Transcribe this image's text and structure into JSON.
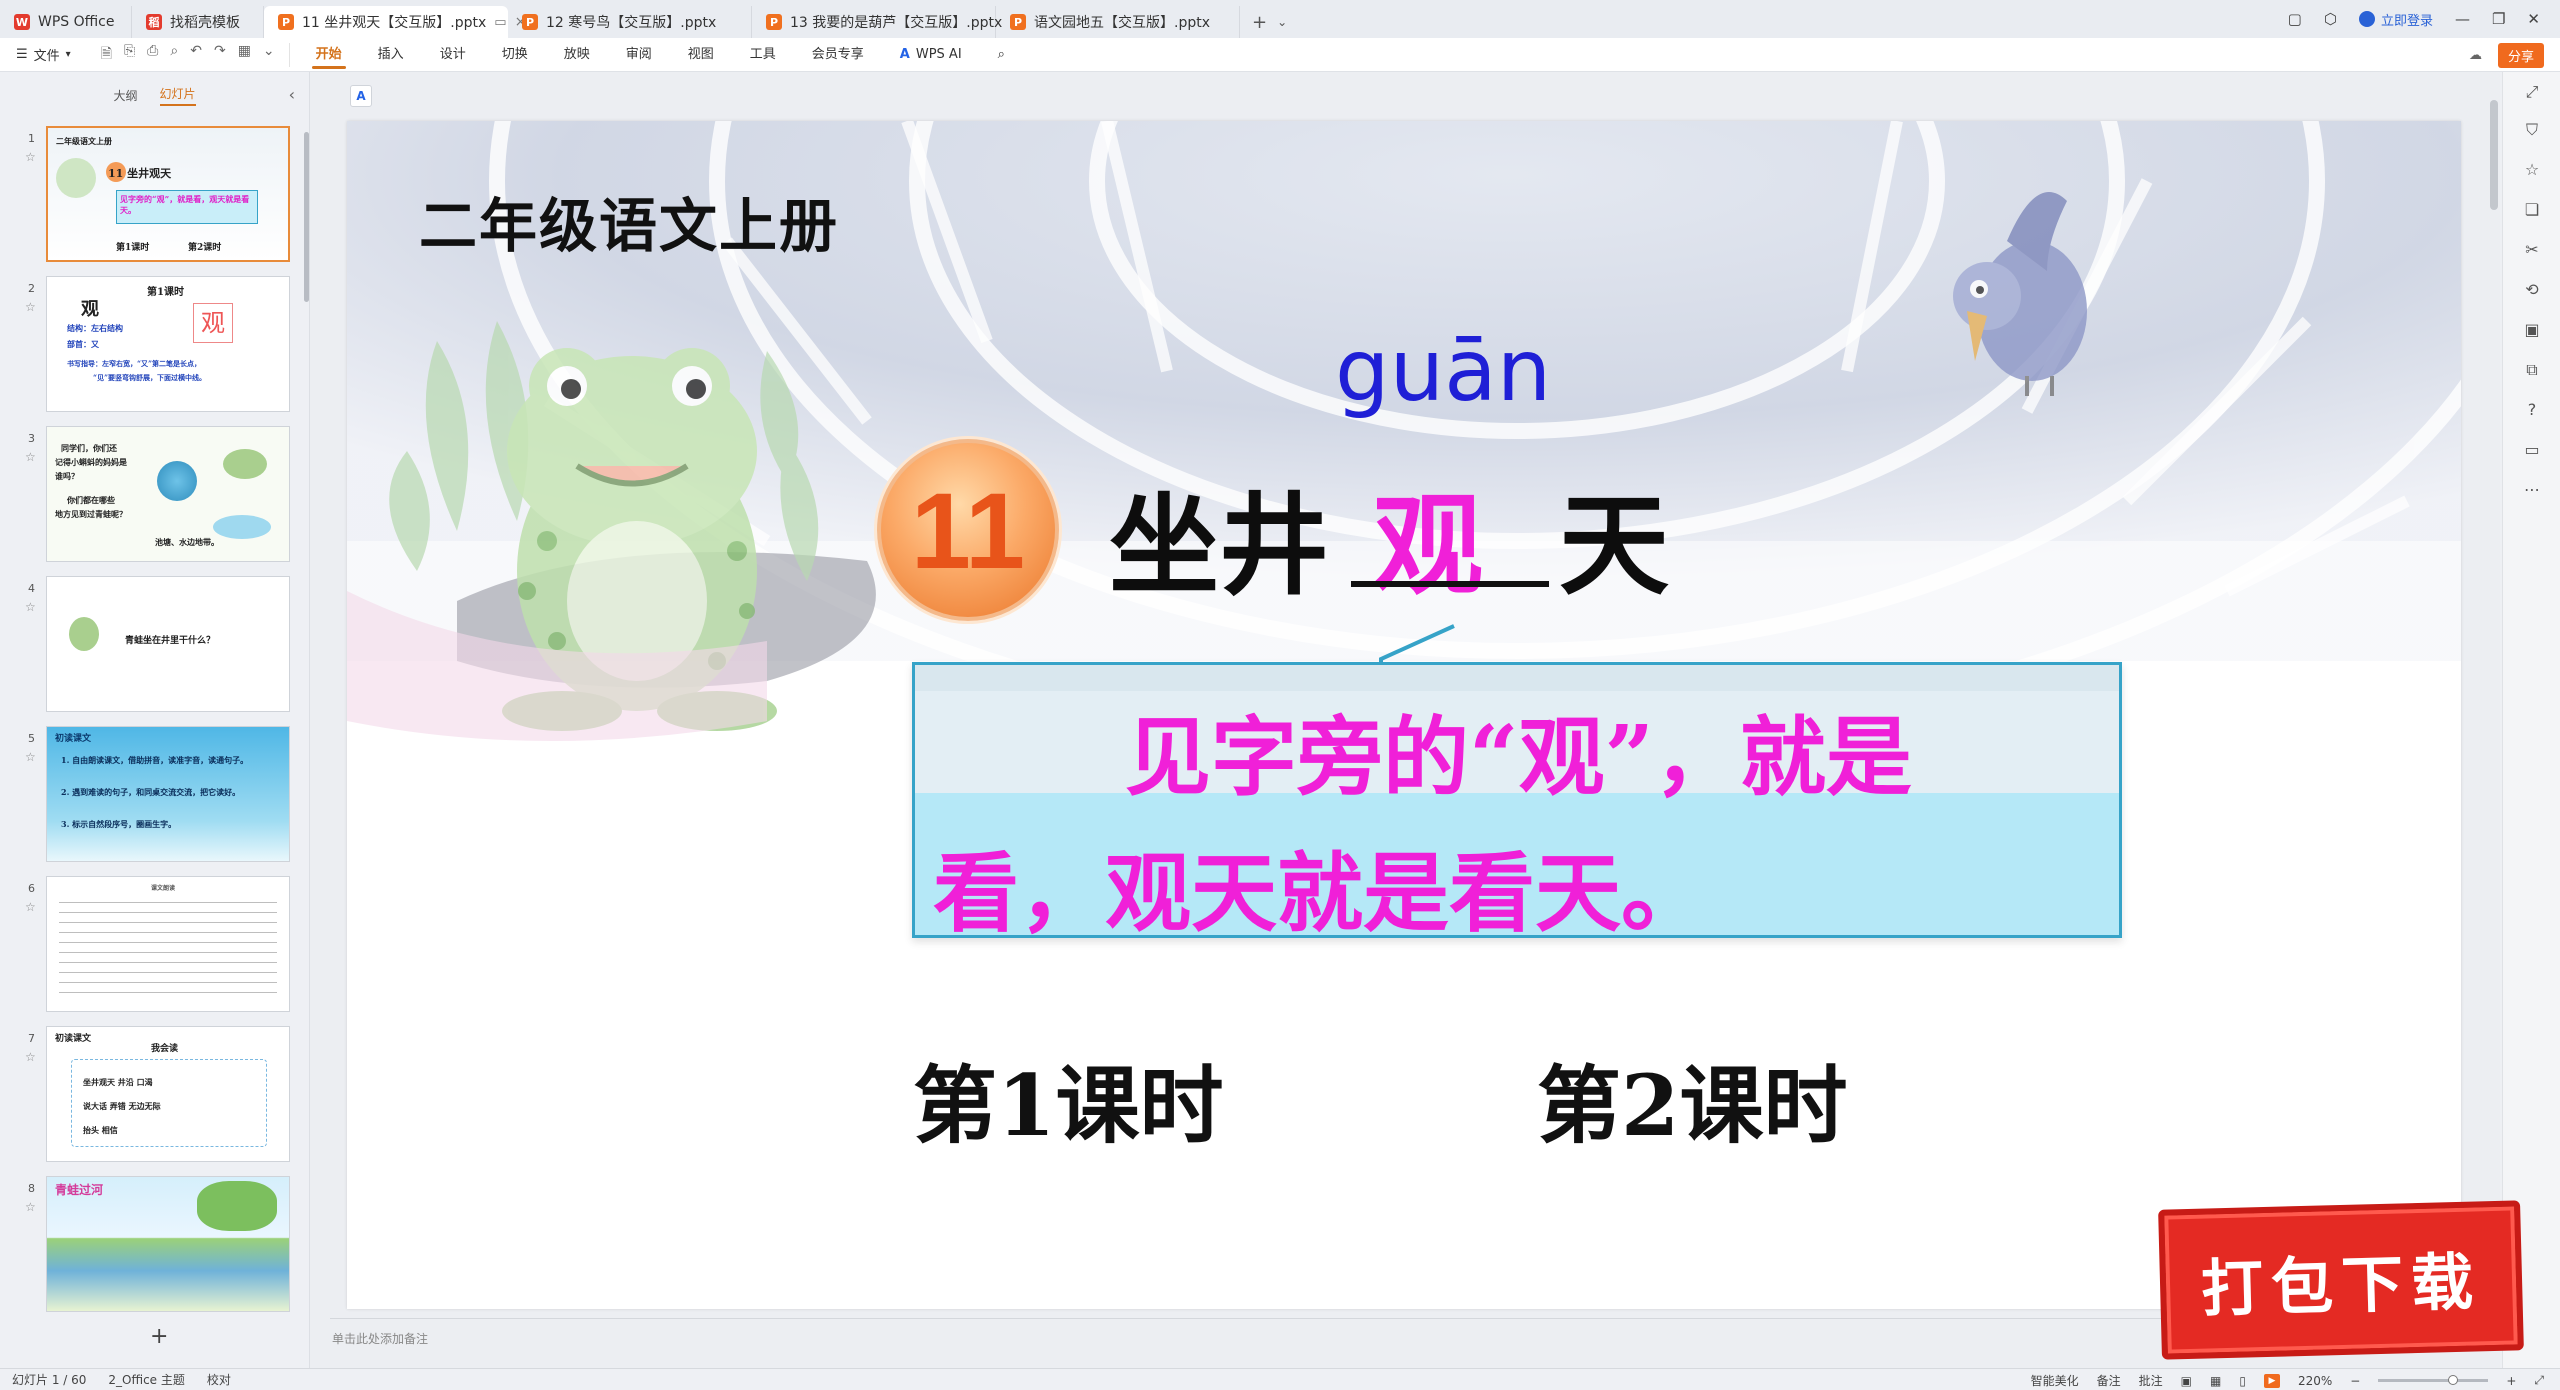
{
  "tabs": [
    {
      "label": "WPS Office",
      "icon": "wps-logo-icon"
    },
    {
      "label": "找稻壳模板",
      "icon": "template-icon"
    },
    {
      "label": "11 坐井观天【交互版】.pptx",
      "icon": "pptx-file-icon",
      "active": true
    },
    {
      "label": "12 寒号鸟【交互版】.pptx",
      "icon": "pptx-file-icon"
    },
    {
      "label": "13 我要的是葫芦【交互版】.pptx",
      "icon": "pptx-file-icon"
    },
    {
      "label": "语文园地五【交互版】.pptx",
      "icon": "pptx-file-icon"
    }
  ],
  "header": {
    "login_label": "立即登录",
    "share_label": "分享"
  },
  "menubar": {
    "file_label": "文件",
    "items": [
      "开始",
      "插入",
      "设计",
      "切换",
      "放映",
      "审阅",
      "视图",
      "工具",
      "会员专享",
      "WPS AI"
    ],
    "active": "开始"
  },
  "leftpanel": {
    "tab_outline": "大纲",
    "tab_slides": "幻灯片",
    "thumbnails": [
      {
        "num": "1",
        "lines": [
          "二年级语文上册",
          "11 坐井观天",
          "见字旁的“观”，就是看，观天就是看天。",
          "第1课时",
          "第2课时"
        ]
      },
      {
        "num": "2",
        "lines": [
          "第1课时",
          "观",
          "结构：左右结构",
          "部首：又",
          "书写指导：左窄右宽，“又”第二笔是长点，",
          "“见”要竖弯钩舒展，下面过横中线。"
        ]
      },
      {
        "num": "3",
        "lines": [
          "同学们，你们还",
          "记得小蝌蚪的妈妈是",
          "谁吗？",
          "你们都在哪些",
          "地方见到过青蛙呢？",
          "池塘、水边地带。"
        ]
      },
      {
        "num": "4",
        "lines": [
          "青蛙坐在井里干什么？"
        ]
      },
      {
        "num": "5",
        "lines": [
          "初读课文",
          "1. 自由朗读课文，借助拼音，读准字音，读通句子。",
          "2. 遇到难读的句子，和同桌交流交流，把它读好。",
          "3. 标示自然段序号，圈画生字。"
        ]
      },
      {
        "num": "6",
        "lines": [
          "课文朗读"
        ]
      },
      {
        "num": "7",
        "lines": [
          "初读课文",
          "我会读",
          "坐井观天  井沿  口渴",
          "说大话  弄错  无边无际",
          "抬头  相信"
        ]
      },
      {
        "num": "8",
        "lines": [
          "青蛙过河"
        ]
      }
    ]
  },
  "slide": {
    "heading": "二年级语文上册",
    "pinyin": "guān",
    "number": "11",
    "title_part1": "坐井",
    "title_char": "观",
    "title_part3": "天",
    "callout_line1": "见字旁的“观”，就是",
    "callout_line2": "看，观天就是看天。",
    "period1": "第1课时",
    "period2": "第2课时"
  },
  "editor": {
    "notes_placeholder": "单击此处添加备注"
  },
  "stamp": {
    "text": "打包下载"
  },
  "statusbar": {
    "slide_counter": "幻灯片 1 / 60",
    "theme": "2_Office 主题",
    "proof": "校对",
    "beautify": "智能美化",
    "notes": "备注",
    "comments": "批注",
    "zoom": "220%"
  },
  "colors": {
    "accent": "#d4731c",
    "magenta": "#f020d8",
    "pinyin_blue": "#1f1fd6",
    "badge_orange": "#f0883f",
    "callout_border": "#36a3c8"
  }
}
